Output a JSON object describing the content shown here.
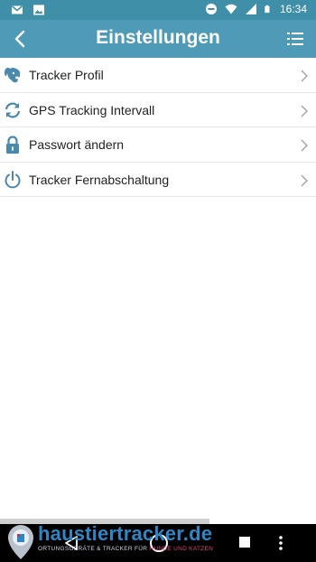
{
  "status_bar": {
    "time": "16:34",
    "icons_left": [
      "gmail-icon",
      "gallery-icon"
    ],
    "icons_right": [
      "do-not-disturb-icon",
      "wifi-icon",
      "signal-icon",
      "battery-icon"
    ]
  },
  "app_bar": {
    "title": "Einstellungen",
    "back_icon": "chevron-left-icon",
    "menu_icon": "list-menu-icon"
  },
  "colors": {
    "status_bar": "#3f8fa9",
    "app_bar": "#4e9ab7",
    "icon_accent": "#4a89ad",
    "text": "#222222",
    "divider": "#e8e8e8"
  },
  "settings_list": [
    {
      "label": "Tracker Profil",
      "icon": "dog-head-icon"
    },
    {
      "label": "GPS Tracking Intervall",
      "icon": "refresh-icon"
    },
    {
      "label": "Passwort ändern",
      "icon": "lock-icon"
    },
    {
      "label": "Tracker Fernabschaltung",
      "icon": "power-icon"
    }
  ],
  "watermark": {
    "title": "haustiertracker.de",
    "subtitle_prefix": "ORTUNGSGERÄTE & TRACKER FÜR ",
    "subtitle_highlight": "HUNDE UND KATZEN"
  },
  "nav_bar": {
    "buttons": [
      "nav-back-icon",
      "nav-home-icon",
      "nav-recents-icon",
      "more-vert-icon"
    ]
  }
}
